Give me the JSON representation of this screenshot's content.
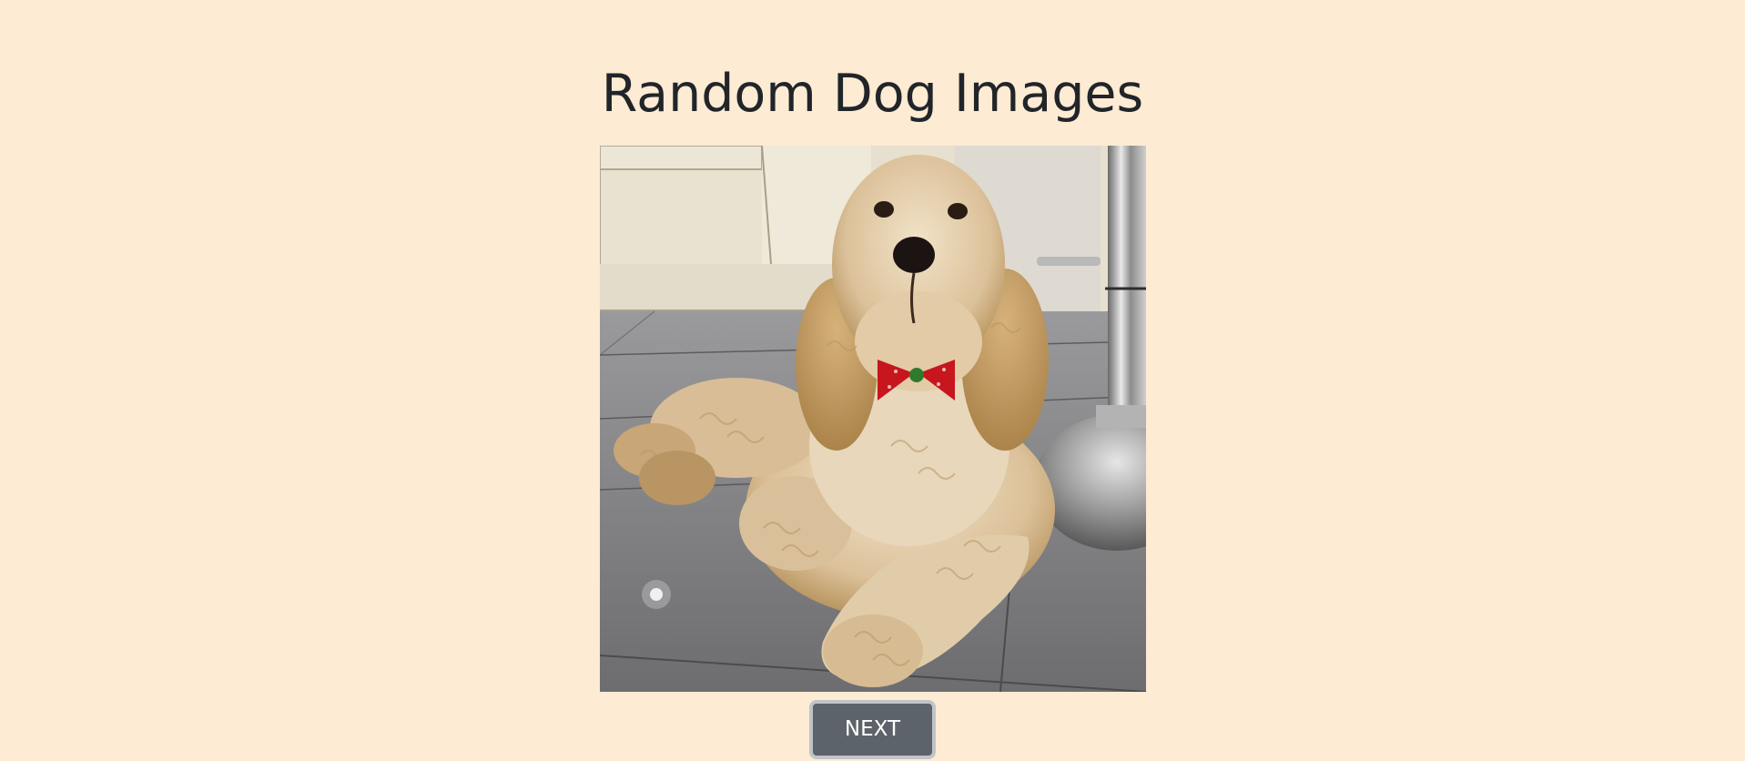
{
  "page": {
    "title": "Random Dog Images"
  },
  "image": {
    "alt": "Random dog image",
    "subject": "fluffy cream-colored dog with red bow tie lying on grey tiled floor"
  },
  "controls": {
    "next_label": "NEXT"
  },
  "colors": {
    "background": "#fdebd3",
    "title": "#212529",
    "button_bg": "#5c636a",
    "button_focus_ring": "#c1c4c8",
    "button_text": "#ffffff"
  }
}
